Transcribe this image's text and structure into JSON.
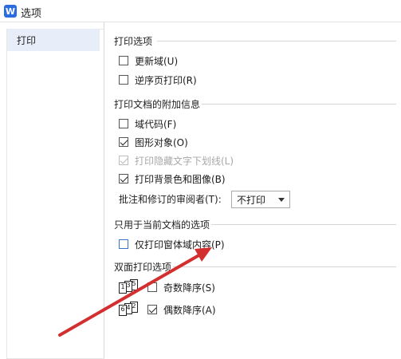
{
  "window": {
    "app_icon": "W",
    "title": "选项"
  },
  "sidebar": {
    "items": [
      {
        "label": "打印",
        "selected": true
      }
    ]
  },
  "sections": {
    "print_options": {
      "title": "打印选项",
      "items": [
        {
          "label": "更新域(U)",
          "checked": false
        },
        {
          "label": "逆序页打印(R)",
          "checked": false
        }
      ]
    },
    "print_doc_info": {
      "title": "打印文档的附加信息",
      "items": [
        {
          "label": "域代码(F)",
          "checked": false,
          "disabled": false
        },
        {
          "label": "图形对象(O)",
          "checked": true,
          "disabled": false
        },
        {
          "label": "打印隐藏文字下划线(L)",
          "checked": true,
          "disabled": true
        },
        {
          "label": "打印背景色和图像(B)",
          "checked": true,
          "disabled": false
        }
      ],
      "reviewer_label": "批注和修订的审阅者(T):",
      "reviewer_value": "不打印"
    },
    "current_doc_only": {
      "title": "只用于当前文档的选项",
      "items": [
        {
          "label": "仅打印窗体域内容(P)",
          "checked": false
        }
      ]
    },
    "duplex": {
      "title": "双面打印选项",
      "items": [
        {
          "label": "奇数降序(S)",
          "checked": false,
          "icon_pages": [
            "1",
            "3",
            "5"
          ]
        },
        {
          "label": "偶数降序(A)",
          "checked": true,
          "icon_pages": [
            "6",
            "4",
            "2"
          ]
        }
      ]
    }
  },
  "colors": {
    "accent": "#2b6cde",
    "selected_bg": "#e7eef9",
    "annotation_arrow": "#d32f2f"
  }
}
